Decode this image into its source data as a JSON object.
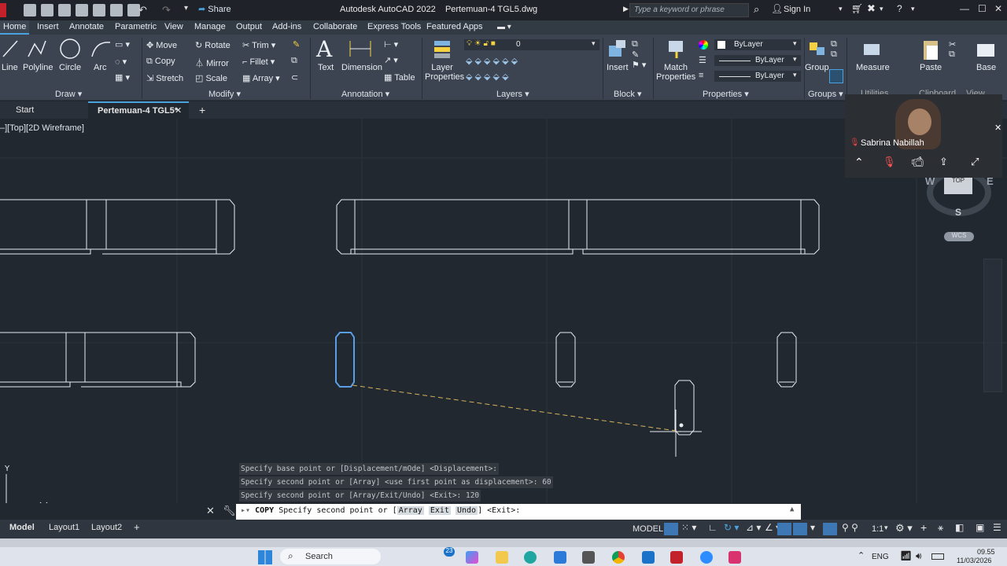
{
  "titlebar": {
    "share_label": "Share",
    "app_name": "Autodesk AutoCAD 2022",
    "file_name": "Pertemuan-4 TGL5.dwg",
    "search_placeholder": "Type a keyword or phrase",
    "signin_label": "Sign In"
  },
  "ribbon_tabs": [
    "Home",
    "Insert",
    "Annotate",
    "Parametric",
    "View",
    "Manage",
    "Output",
    "Add-ins",
    "Collaborate",
    "Express Tools",
    "Featured Apps"
  ],
  "draw_panel": {
    "title": "Draw",
    "line": "Line",
    "polyline": "Polyline",
    "circle": "Circle",
    "arc": "Arc"
  },
  "modify_panel": {
    "title": "Modify",
    "move": "Move",
    "rotate": "Rotate",
    "trim": "Trim",
    "copy": "Copy",
    "mirror": "Mirror",
    "fillet": "Fillet",
    "stretch": "Stretch",
    "scale": "Scale",
    "array": "Array"
  },
  "annotation_panel": {
    "title": "Annotation",
    "text": "Text",
    "dimension": "Dimension",
    "table": "Table"
  },
  "layers_panel": {
    "title": "Layers",
    "layer_properties_1": "Layer",
    "layer_properties_2": "Properties",
    "current_layer": "0"
  },
  "block_panel": {
    "title": "Block",
    "insert": "Insert"
  },
  "properties_panel": {
    "title": "Properties",
    "match_1": "Match",
    "match_2": "Properties",
    "color": "ByLayer",
    "linetype": "ByLayer",
    "lineweight": "ByLayer"
  },
  "groups_panel": {
    "title": "Groups",
    "group": "Group"
  },
  "utilities": {
    "measure": "Measure",
    "title": "Utilities"
  },
  "clipboard": {
    "paste": "Paste",
    "title": "Clipboard"
  },
  "base": {
    "label": "Base",
    "title": "View"
  },
  "doc_tabs": {
    "start": "Start",
    "active": "Pertemuan-4 TGL5*",
    "close": "✕",
    "add": "+"
  },
  "viewport_label": "–][Top][2D Wireframe]",
  "viewcube": {
    "west": "W",
    "east": "E",
    "south": "S",
    "top": "TOP",
    "wcs": "WCS"
  },
  "video": {
    "participant": "Sabrina Nabillah"
  },
  "command_history": [
    "Specify base point or [Displacement/mOde] <Displacement>:",
    "Specify second point or [Array] <use first point as displacement>: 60",
    "Specify second point or [Array/Exit/Undo] <Exit>: 120"
  ],
  "command_line": {
    "command": "COPY",
    "prompt": "Specify second point or [",
    "kw1": "Array",
    "kw2": "Exit",
    "kw3": "Undo",
    "suffix": "] <Exit>:"
  },
  "layout_tabs": [
    "Model",
    "Layout1",
    "Layout2"
  ],
  "status": {
    "model": "MODEL",
    "scale": "1:1"
  },
  "taskbar": {
    "search": "Search",
    "language": "ENG",
    "time": "09.55",
    "date": "11/03/2026",
    "badge": "23"
  }
}
